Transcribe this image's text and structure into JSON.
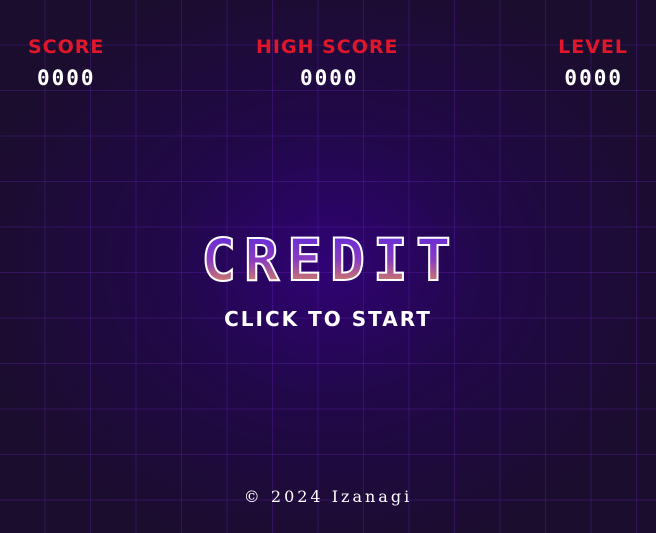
{
  "hud": {
    "score_label": "SCORE",
    "score_value": "0000",
    "high_score_label": "HIGH SCORE",
    "high_score_value": "0000",
    "level_label": "LEVEL",
    "level_value": "0000"
  },
  "title": {
    "text": "CREDIT"
  },
  "prompt": {
    "start_label": "CLICK TO START"
  },
  "footer": {
    "copyright": "© 2024 Izanagi"
  },
  "colors": {
    "background": "#1b0d2e",
    "glow": "#340082",
    "grid": "#6e28c8",
    "hud_label": "#e0162b",
    "hud_value": "#ffffff",
    "title_gradient_top": "#5a28e0",
    "title_gradient_bottom": "#f29a3a",
    "title_stroke": "#ffffff"
  }
}
